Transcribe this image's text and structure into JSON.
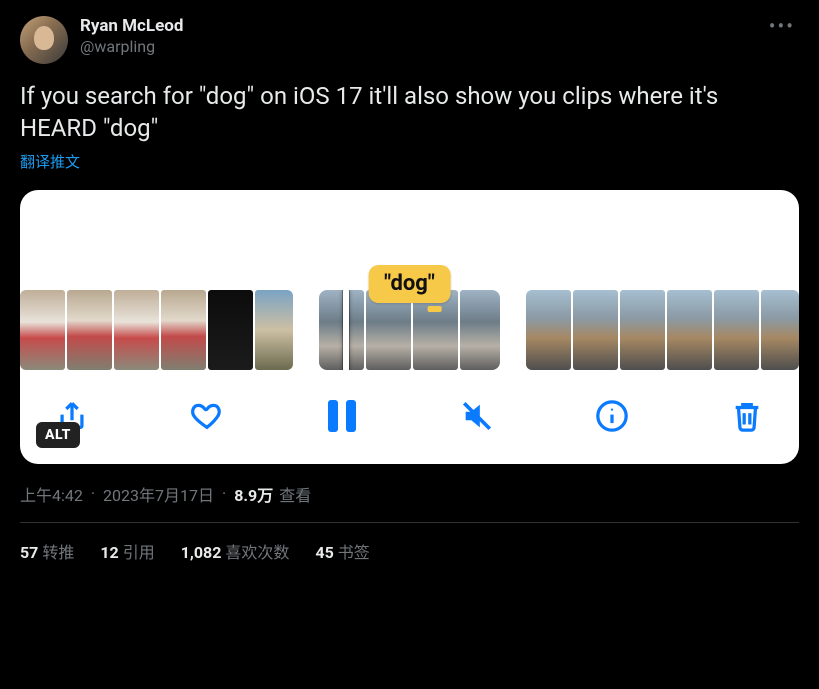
{
  "author": {
    "display_name": "Ryan McLeod",
    "handle": "@warpling"
  },
  "tweet_text": "If you search for \"dog\" on iOS 17 it'll also show you clips where it's HEARD \"dog\"",
  "translate_label": "翻译推文",
  "media": {
    "search_term": "\"dog\"",
    "alt_badge": "ALT"
  },
  "meta": {
    "time": "上午4:42",
    "date": "2023年7月17日",
    "views_count": "8.9万",
    "views_label": "查看"
  },
  "stats": {
    "retweets": {
      "count": "57",
      "label": "转推"
    },
    "quotes": {
      "count": "12",
      "label": "引用"
    },
    "likes": {
      "count": "1,082",
      "label": "喜欢次数"
    },
    "bookmarks": {
      "count": "45",
      "label": "书签"
    }
  }
}
